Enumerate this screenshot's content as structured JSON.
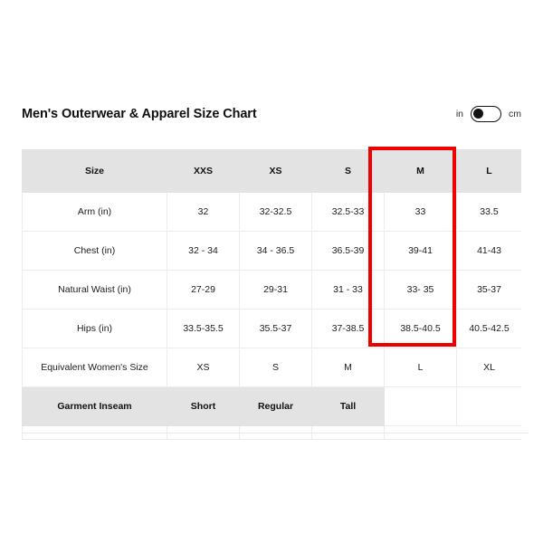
{
  "header": {
    "title": "Men's Outerwear & Apparel Size Chart",
    "unit_toggle": {
      "left_label": "in",
      "right_label": "cm",
      "selected": "in"
    }
  },
  "colors": {
    "highlight": "#ee0000",
    "header_background": "#e3e3e3",
    "grid_line": "#ececec",
    "text": "#1c1c1c"
  },
  "table": {
    "columns": [
      "Size",
      "XXS",
      "XS",
      "S",
      "M",
      "L"
    ],
    "highlighted_column": "M",
    "rows": [
      {
        "label": "Arm (in)",
        "values": [
          "32",
          "32-32.5",
          "32.5-33",
          "33",
          "33.5"
        ]
      },
      {
        "label": "Chest (in)",
        "values": [
          "32 - 34",
          "34 - 36.5",
          "36.5-39",
          "39-41",
          "41-43"
        ]
      },
      {
        "label": "Natural Waist (in)",
        "values": [
          "27-29",
          "29-31",
          "31 - 33",
          "33- 35",
          "35-37"
        ]
      },
      {
        "label": "Hips (in)",
        "values": [
          "33.5-35.5",
          "35.5-37",
          "37-38.5",
          "38.5-40.5",
          "40.5-42.5"
        ]
      },
      {
        "label": "Equivalent Women's Size",
        "values": [
          "XS",
          "S",
          "M",
          "L",
          "XL"
        ]
      }
    ],
    "inseam_row": {
      "label": "Garment Inseam",
      "values": [
        "Short",
        "Regular",
        "Tall"
      ]
    }
  }
}
